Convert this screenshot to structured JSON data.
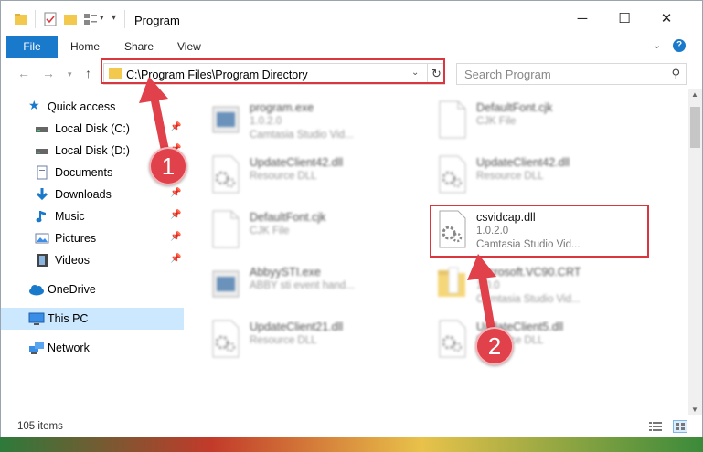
{
  "window": {
    "title": "Program",
    "controls": {
      "minimize": "─",
      "maximize": "☐",
      "close": "✕"
    }
  },
  "ribbon": {
    "tabs": [
      "File",
      "Home",
      "Share",
      "View"
    ],
    "help": "?"
  },
  "navigation": {
    "address": "C:\\Program Files\\Program Directory",
    "search_placeholder": "Search Program"
  },
  "sidebar": {
    "quick_access": "Quick access",
    "items": [
      {
        "label": "Local Disk (C:)",
        "icon": "drive-icon",
        "pinned": true
      },
      {
        "label": "Local Disk (D:)",
        "icon": "drive-icon",
        "pinned": true
      },
      {
        "label": "Documents",
        "icon": "documents-icon",
        "pinned": true
      },
      {
        "label": "Downloads",
        "icon": "downloads-icon",
        "pinned": true
      },
      {
        "label": "Music",
        "icon": "music-icon",
        "pinned": true
      },
      {
        "label": "Pictures",
        "icon": "pictures-icon",
        "pinned": true
      },
      {
        "label": "Videos",
        "icon": "videos-icon",
        "pinned": true
      }
    ],
    "onedrive": "OneDrive",
    "this_pc": "This PC",
    "network": "Network"
  },
  "files": {
    "left": [
      {
        "name": "program.exe",
        "line2": "1.0.2.0",
        "line3": "Camtasia Studio Vid...",
        "icon": "exe-icon"
      },
      {
        "name": "UpdateClient42.dll",
        "line2": "Resource DLL",
        "line3": "",
        "icon": "dll-icon"
      },
      {
        "name": "DefaultFont.cjk",
        "line2": "CJK File",
        "line3": "",
        "icon": "file-icon"
      },
      {
        "name": "AbbyySTI.exe",
        "line2": "ABBY sti event hand...",
        "line3": "",
        "icon": "exe-icon"
      },
      {
        "name": "UpdateClient21.dll",
        "line2": "Resource DLL",
        "line3": "",
        "icon": "dll-icon"
      }
    ],
    "right": [
      {
        "name": "DefaultFont.cjk",
        "line2": "CJK File",
        "line3": "",
        "icon": "file-icon"
      },
      {
        "name": "UpdateClient42.dll",
        "line2": "Resource DLL",
        "line3": "",
        "icon": "dll-icon"
      },
      {
        "name": "csvidcap.dll",
        "line2": "1.0.2.0",
        "line3": "Camtasia Studio Vid...",
        "icon": "dll-icon"
      },
      {
        "name": "Microsoft.VC90.CRT",
        "line2": "1.0.0",
        "line3": "Camtasia Studio Vid...",
        "icon": "folder-icon"
      },
      {
        "name": "UpdateClient5.dll",
        "line2": "Resource DLL",
        "line3": "",
        "icon": "dll-icon"
      }
    ]
  },
  "status": {
    "item_count": "105 items"
  },
  "callouts": [
    "1",
    "2"
  ],
  "colors": {
    "accent": "#1979ca",
    "highlight": "#d9363e",
    "selected": "#cce8ff"
  }
}
